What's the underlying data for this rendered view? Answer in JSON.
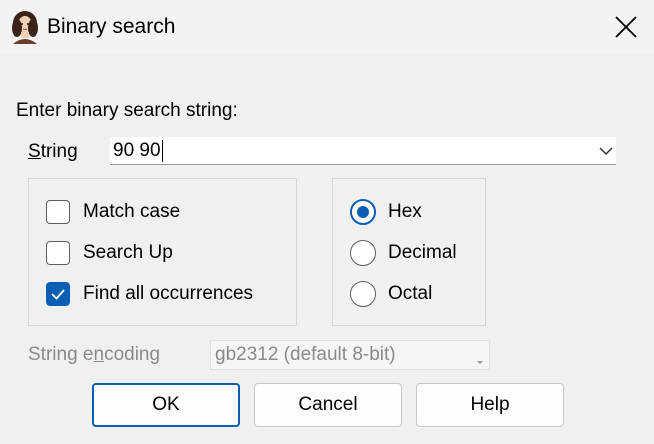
{
  "window": {
    "title": "Binary search"
  },
  "prompt": "Enter binary search string:",
  "string_field": {
    "label_prefix": "",
    "label_underline": "S",
    "label_rest": "tring",
    "value": "90 90"
  },
  "options": [
    {
      "label": "Match case",
      "checked": false
    },
    {
      "label": "Search Up",
      "checked": false
    },
    {
      "label": "Find all occurrences",
      "checked": true
    }
  ],
  "format": [
    {
      "label": "Hex",
      "selected": true
    },
    {
      "label": "Decimal",
      "selected": false
    },
    {
      "label": "Octal",
      "selected": false
    }
  ],
  "encoding": {
    "label_prefix": "String e",
    "label_underline": "n",
    "label_rest": "coding",
    "value": "gb2312 (default 8-bit)",
    "enabled": false
  },
  "buttons": {
    "ok": "OK",
    "cancel": "Cancel",
    "help": "Help"
  },
  "colors": {
    "accent": "#0a5fb5",
    "background": "#f0f0f0",
    "disabled_text": "#8a8a8a"
  },
  "icons": {
    "app": "portrait-icon",
    "close": "close-icon",
    "dropdown": "chevron-down-icon",
    "check": "checkmark-icon"
  }
}
